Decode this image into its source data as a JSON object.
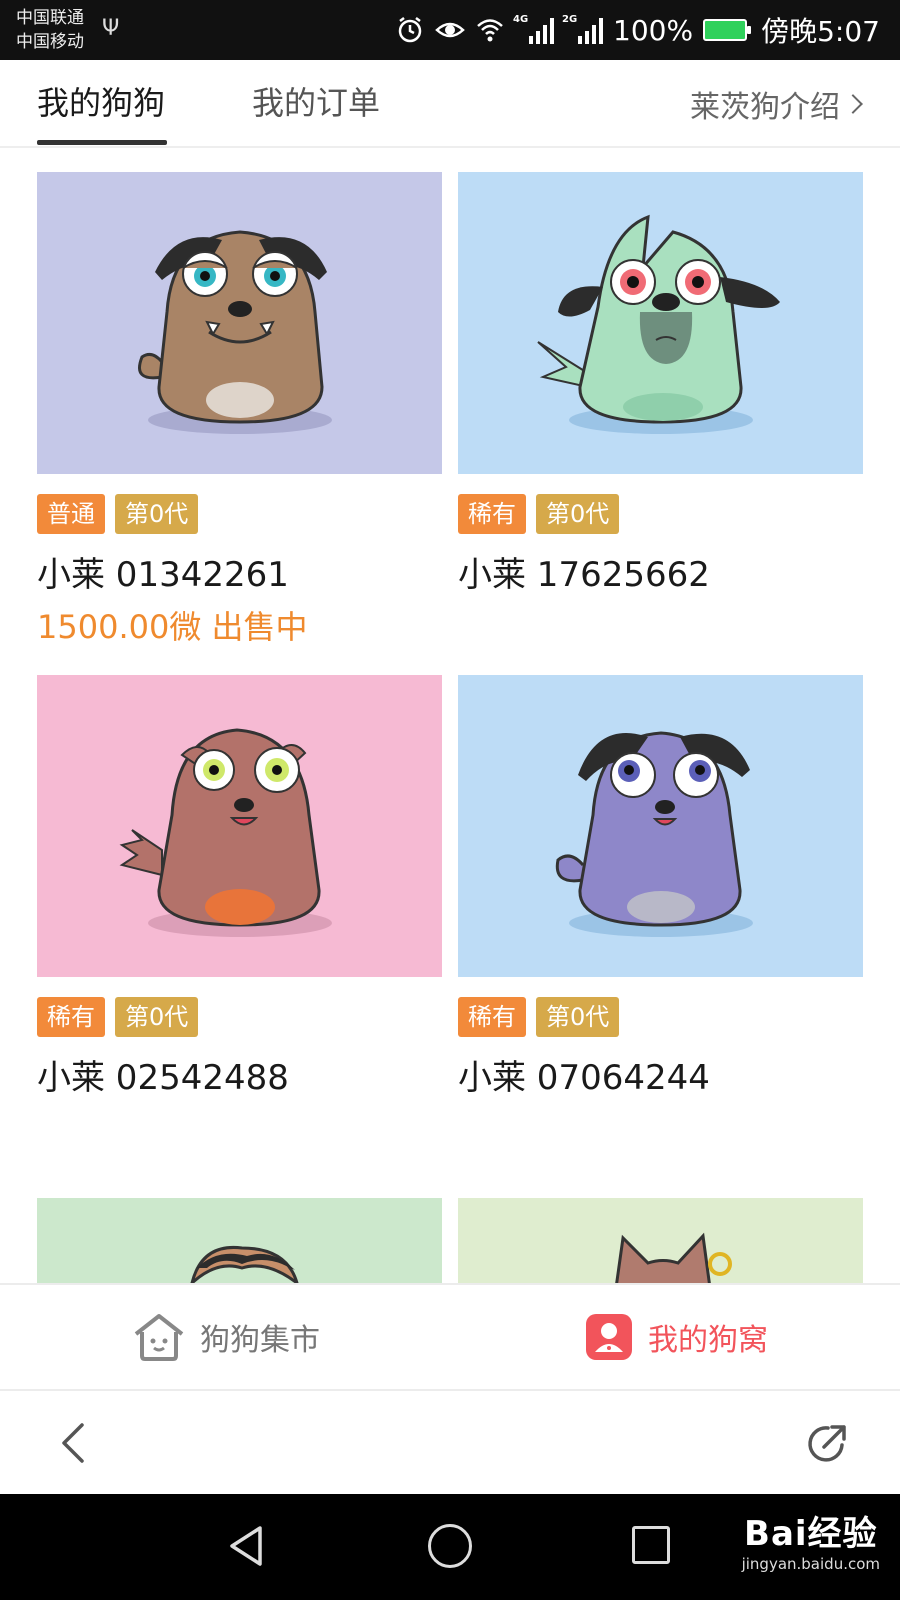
{
  "status_bar": {
    "carrier1": "中国联通",
    "carrier2": "中国移动",
    "net1": "4G",
    "net2": "2G",
    "battery": "100%",
    "time": "傍晚5:07"
  },
  "tabs": {
    "items": [
      {
        "label": "我的狗狗",
        "active": true
      },
      {
        "label": "我的订单",
        "active": false
      }
    ],
    "intro_link": "莱茨狗介绍"
  },
  "dogs": [
    {
      "rarity": "普通",
      "generation": "第0代",
      "name": "小莱 01342261",
      "price_status": "1500.00微 出售中",
      "bg": "#c5c8e8",
      "body": "#a98466"
    },
    {
      "rarity": "稀有",
      "generation": "第0代",
      "name": "小莱 17625662",
      "price_status": "",
      "bg": "#bddcf6",
      "body": "#a9e0bf"
    },
    {
      "rarity": "稀有",
      "generation": "第0代",
      "name": "小莱 02542488",
      "price_status": "",
      "bg": "#f6bad3",
      "body": "#b3726a"
    },
    {
      "rarity": "稀有",
      "generation": "第0代",
      "name": "小莱 07064244",
      "price_status": "",
      "bg": "#bddcf6",
      "body": "#8e87c9"
    },
    {
      "bg": "#cce8cc"
    },
    {
      "bg": "#dfedcf"
    }
  ],
  "bottom_nav": {
    "market_label": "狗狗集市",
    "kennel_label": "我的狗窝"
  },
  "colors": {
    "accent": "#f2545b",
    "price": "#ef8a2e",
    "rare_badge": "#f28a3a",
    "gen_badge": "#d6a94a"
  },
  "icons": {
    "market": "dog-house-icon",
    "kennel": "user-icon",
    "back": "chevron-left-icon",
    "share": "share-icon"
  },
  "watermark": {
    "logo": "Bai经验",
    "url": "jingyan.baidu.com"
  }
}
